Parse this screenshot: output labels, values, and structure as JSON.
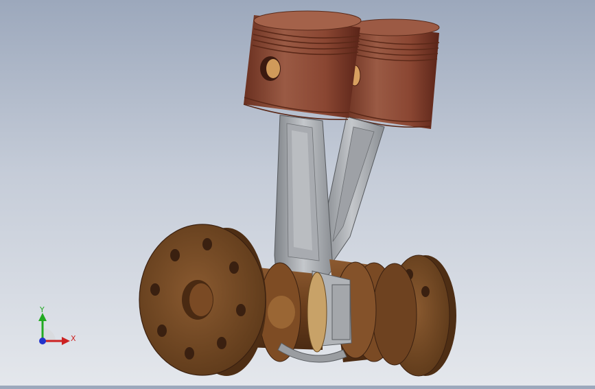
{
  "viewport": {
    "model_description": "piston-rod-crankshaft-assembly",
    "colors": {
      "background_top": "#9ca8bc",
      "background_bottom": "#e4e7ec",
      "piston": "#8a4a36",
      "rod": "#a2a5aa",
      "crank": "#7a4a26"
    }
  },
  "triad": {
    "x_label": "X",
    "y_label": "Y",
    "x_color": "#cc2222",
    "y_color": "#22aa22",
    "z_color": "#2233cc"
  }
}
